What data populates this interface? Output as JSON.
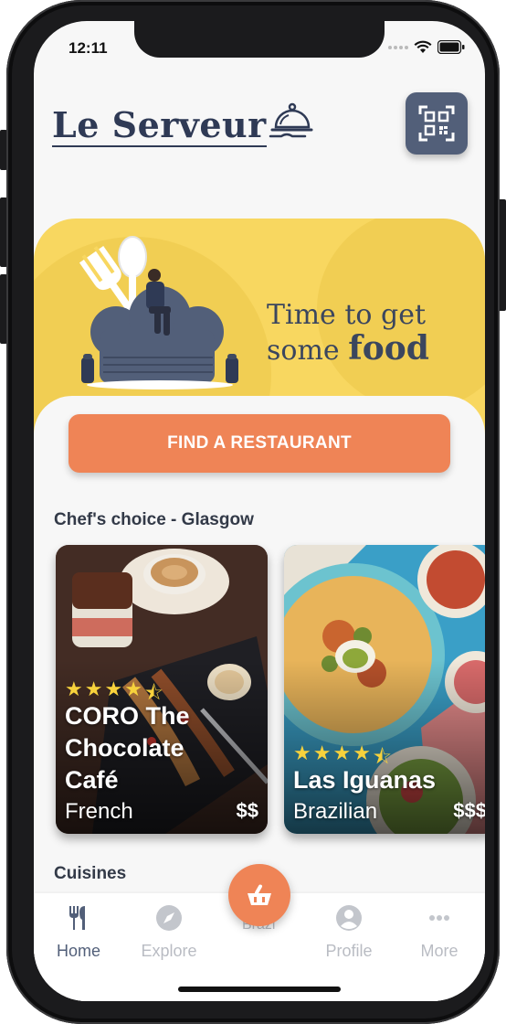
{
  "status": {
    "time": "12:11"
  },
  "header": {
    "brand": "Le Serveur",
    "qr_label": ""
  },
  "hero": {
    "line1": "Time to get",
    "line2_prefix": "some ",
    "line2_bold": "food"
  },
  "cta": {
    "label": "FIND A RESTAURANT"
  },
  "chefs_choice": {
    "title": "Chef's choice - Glasgow",
    "cards": [
      {
        "name_line1": "CORO The",
        "name_line2": "Chocolate",
        "name_line3": "Café",
        "cuisine": "French",
        "price": "$$",
        "rating": 4.5
      },
      {
        "name_line1": "Las Iguanas",
        "cuisine": "Brazilian",
        "price": "$$$",
        "rating": 4.5
      }
    ]
  },
  "cuisines": {
    "title": "Cuisines",
    "peek_label": "Brazi"
  },
  "tabbar": {
    "items": [
      {
        "label": "Home",
        "icon": "cutlery-icon",
        "active": true
      },
      {
        "label": "Explore",
        "icon": "compass-icon",
        "active": false
      },
      {
        "label": "Profile",
        "icon": "user-icon",
        "active": false
      },
      {
        "label": "More",
        "icon": "ellipsis-icon",
        "active": false
      }
    ],
    "center_icon": "basket-icon"
  },
  "colors": {
    "accent": "#ef8456",
    "hero": "#f8d760",
    "navy": "#525f79",
    "text": "#2f3a55"
  }
}
